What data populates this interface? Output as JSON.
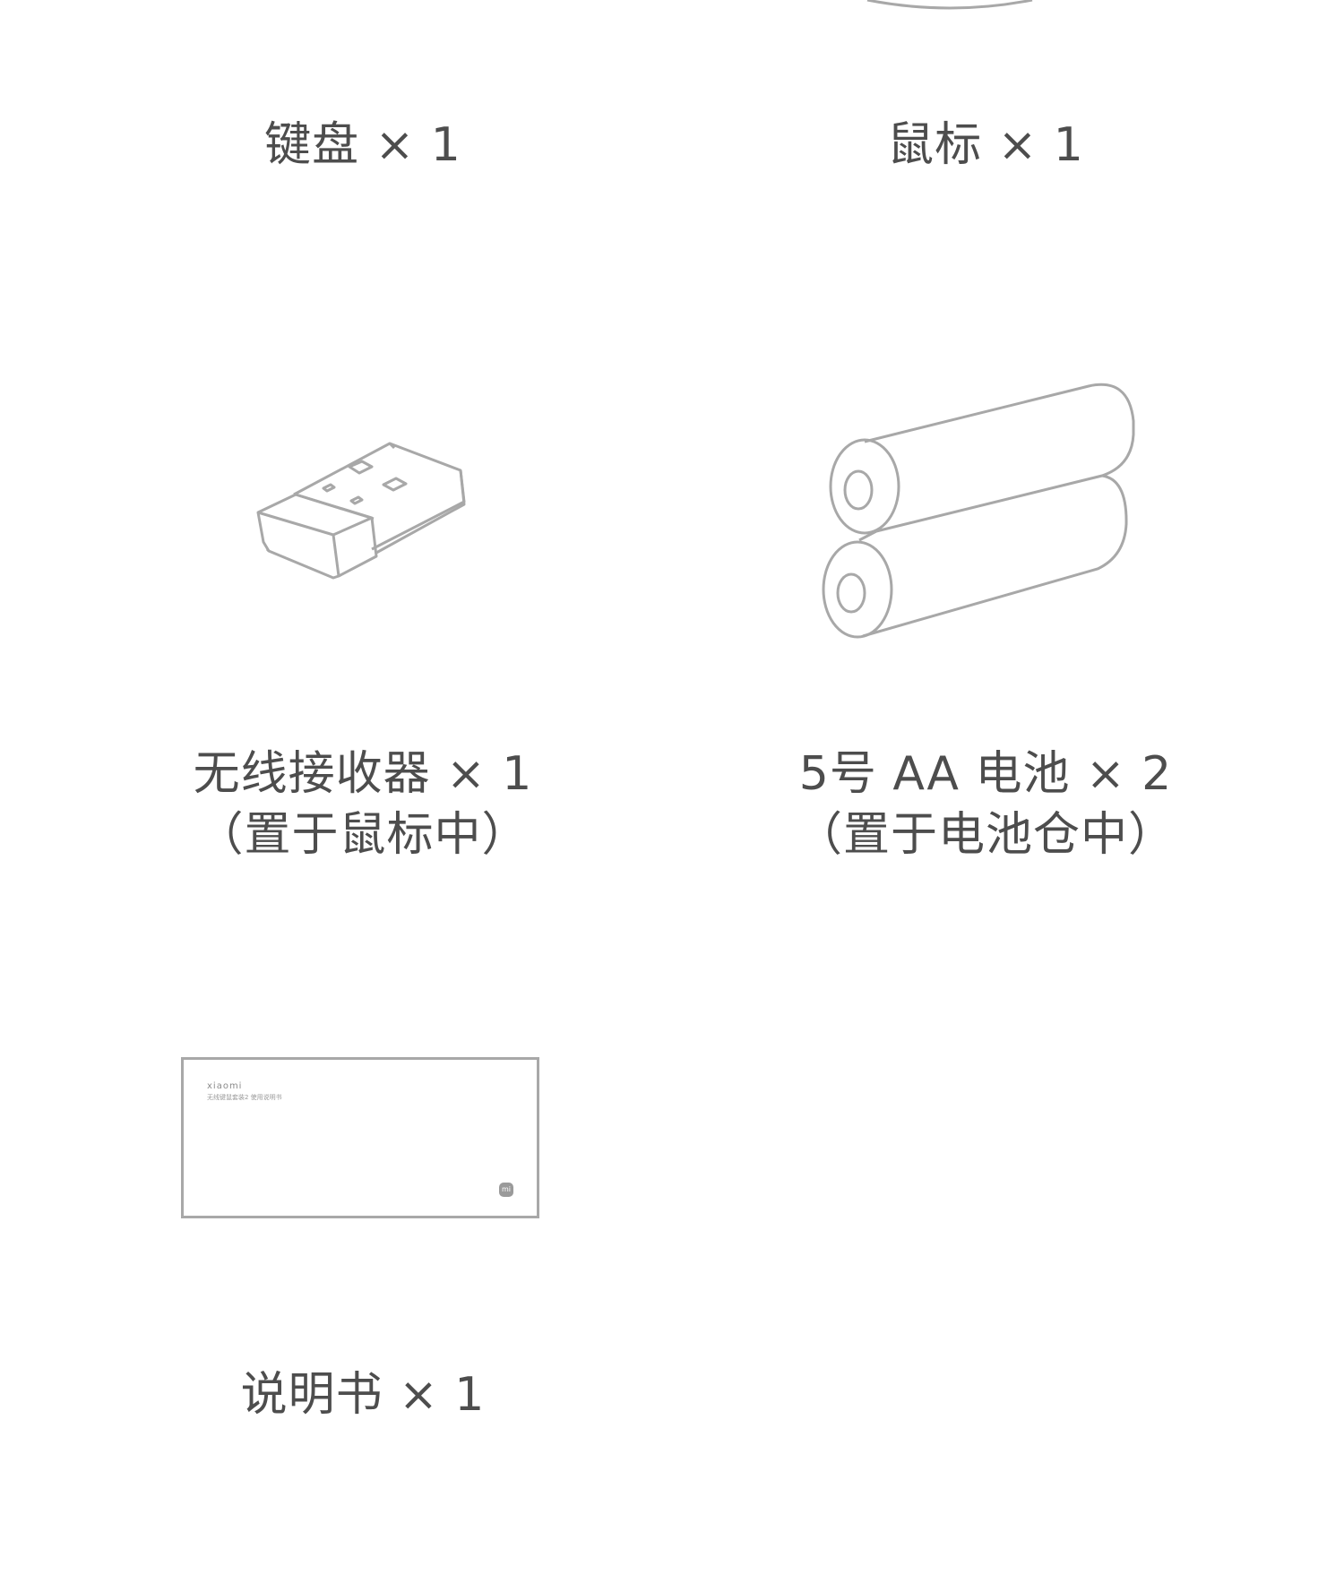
{
  "items": [
    {
      "label": "键盘 × 1"
    },
    {
      "label": "鼠标 × 1"
    },
    {
      "label_line1": "无线接收器 × 1",
      "label_line2": "（置于鼠标中）"
    },
    {
      "label_line1": "5号 AA 电池 × 2",
      "label_line2": "（置于电池仓中）"
    },
    {
      "label": "说明书 × 1"
    }
  ],
  "manual": {
    "brand": "xiaomi",
    "title": "无线键鼠套装2 使用说明书",
    "logo": "mi"
  },
  "colors": {
    "line": "#a8a8a8",
    "text": "#4d4d4d"
  }
}
